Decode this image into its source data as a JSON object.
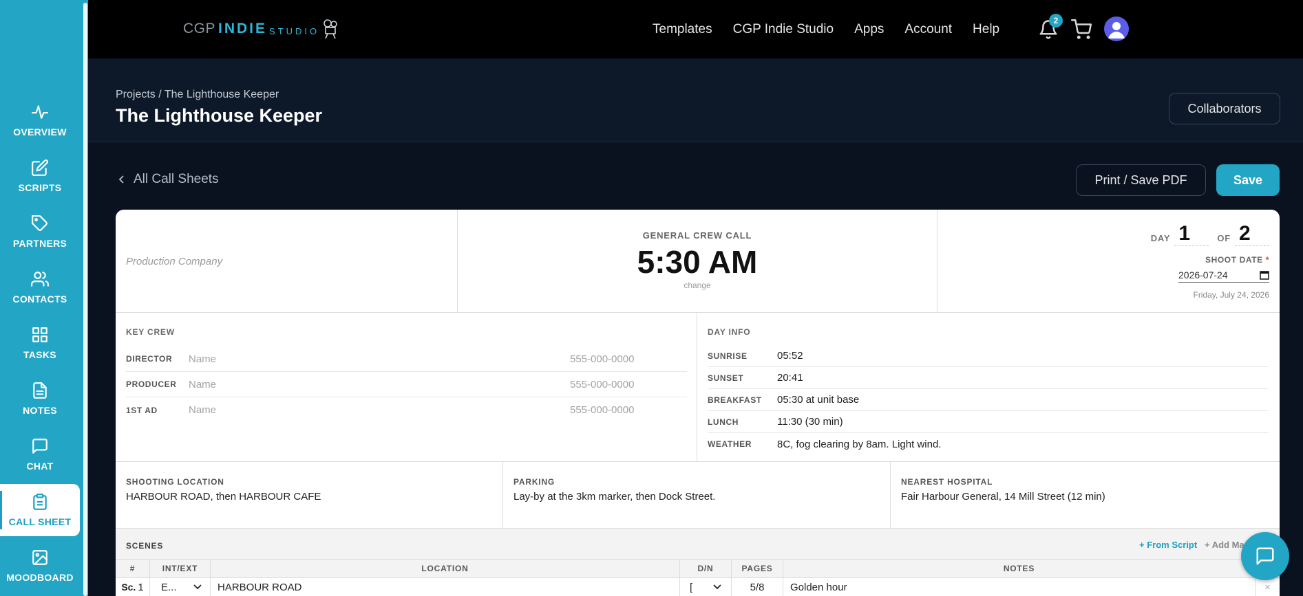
{
  "sidebar": {
    "items": [
      {
        "label": "OVERVIEW",
        "icon": "activity-icon"
      },
      {
        "label": "SCRIPTS",
        "icon": "edit-icon"
      },
      {
        "label": "PARTNERS",
        "icon": "tag-icon"
      },
      {
        "label": "CONTACTS",
        "icon": "users-icon"
      },
      {
        "label": "TASKS",
        "icon": "grid-icon"
      },
      {
        "label": "NOTES",
        "icon": "file-text-icon"
      },
      {
        "label": "CHAT",
        "icon": "message-icon"
      },
      {
        "label": "CALL SHEET",
        "icon": "clipboard-icon",
        "active": true
      },
      {
        "label": "MOODBOARD",
        "icon": "image-icon"
      }
    ]
  },
  "topbar": {
    "logo": {
      "part1": "CGP",
      "part2": "INDIE",
      "part3": "STUDIO"
    },
    "nav": [
      "Templates",
      "CGP Indie Studio",
      "Apps",
      "Account",
      "Help"
    ],
    "notification_count": "2"
  },
  "project": {
    "breadcrumb": "Projects / The Lighthouse Keeper",
    "title": "The Lighthouse Keeper",
    "collaborators_label": "Collaborators"
  },
  "actions": {
    "back_label": "All Call Sheets",
    "print_label": "Print / Save PDF",
    "save_label": "Save"
  },
  "sheet": {
    "company_placeholder": "Production Company",
    "general_call_label": "GENERAL CREW CALL",
    "general_call_time": "5:30 AM",
    "change_label": "change",
    "day_label": "DAY",
    "day_value": "1",
    "of_label": "OF",
    "of_value": "2",
    "shoot_date_label": "SHOOT DATE",
    "shoot_date_required": "*",
    "shoot_date_value": "2026-07-24",
    "shoot_date_long": "Friday, July 24, 2026",
    "key_crew": {
      "label": "KEY CREW",
      "rows": [
        {
          "role": "DIRECTOR",
          "name": "Name",
          "phone": "555-000-0000"
        },
        {
          "role": "PRODUCER",
          "name": "Name",
          "phone": "555-000-0000"
        },
        {
          "role": "1ST AD",
          "name": "Name",
          "phone": "555-000-0000"
        }
      ]
    },
    "day_info": {
      "label": "DAY INFO",
      "rows": [
        {
          "key": "SUNRISE",
          "value": "05:52"
        },
        {
          "key": "SUNSET",
          "value": "20:41"
        },
        {
          "key": "BREAKFAST",
          "value": "05:30 at unit base"
        },
        {
          "key": "LUNCH",
          "value": "11:30 (30 min)"
        },
        {
          "key": "WEATHER",
          "value": "8C, fog clearing by 8am. Light wind."
        }
      ]
    },
    "locations": [
      {
        "key": "SHOOTING LOCATION",
        "value": "HARBOUR ROAD, then HARBOUR CAFE"
      },
      {
        "key": "PARKING",
        "value": "Lay-by at the 3km marker, then Dock Street."
      },
      {
        "key": "NEAREST HOSPITAL",
        "value": "Fair Harbour General, 14 Mill Street (12 min)"
      }
    ],
    "scenes": {
      "label": "SCENES",
      "from_script": "+ From Script",
      "add_manual": "+ Add Ma",
      "columns": [
        "#",
        "INT/EXT",
        "LOCATION",
        "D/N",
        "PAGES",
        "NOTES"
      ],
      "rows": [
        {
          "sc_prefix": "Sc.",
          "num": "1",
          "intext": "E...",
          "location": "HARBOUR ROAD",
          "dn": "[",
          "pages": "5/8",
          "notes": "Golden hour",
          "remove": "×"
        }
      ]
    }
  }
}
